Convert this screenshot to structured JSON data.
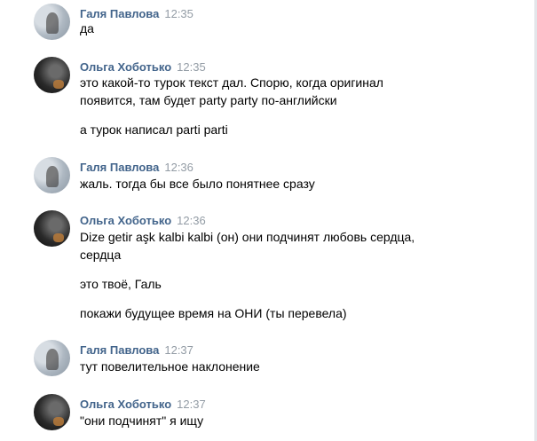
{
  "messages": [
    {
      "author": "Галя Павлова",
      "time": "12:35",
      "lines": [
        "да"
      ]
    },
    {
      "author": "Ольга Хоботько",
      "time": "12:35",
      "lines": [
        "это какой-то турок текст дал. Спорю, когда оригинал",
        "появится, там будет party party по-английски",
        "а турок написал parti parti"
      ]
    },
    {
      "author": "Галя Павлова",
      "time": "12:36",
      "lines": [
        "жаль. тогда бы все было понятнее сразу"
      ]
    },
    {
      "author": "Ольга Хоботько",
      "time": "12:36",
      "lines": [
        "Dize getir aşk kalbi kalbi (он) они подчинят любовь сердца,",
        "сердца",
        "это твоё, Галь",
        "покажи будущее время на ОНИ (ты перевела)"
      ]
    },
    {
      "author": "Галя Павлова",
      "time": "12:37",
      "lines": [
        "тут повелительное наклонение"
      ]
    },
    {
      "author": "Ольга Хоботько",
      "time": "12:37",
      "lines": [
        "\"они подчинят\" я ищу"
      ]
    }
  ]
}
